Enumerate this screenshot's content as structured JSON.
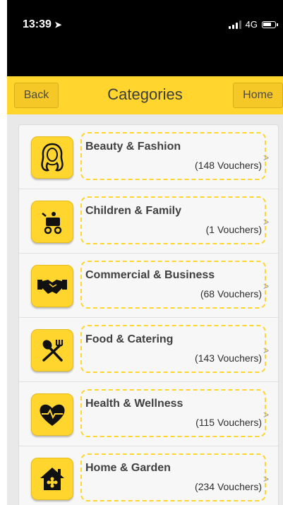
{
  "status": {
    "time": "13:39",
    "network": "4G"
  },
  "nav": {
    "back_label": "Back",
    "title": "Categories",
    "home_label": "Home"
  },
  "categories": [
    {
      "name": "Beauty & Fashion",
      "count": "(148 Vouchers)",
      "icon": "beauty-icon"
    },
    {
      "name": "Children & Family",
      "count": "(1 Vouchers)",
      "icon": "stroller-icon"
    },
    {
      "name": "Commercial & Business",
      "count": "(68 Vouchers)",
      "icon": "handshake-icon"
    },
    {
      "name": "Food & Catering",
      "count": "(143 Vouchers)",
      "icon": "fork-spoon-icon"
    },
    {
      "name": "Health & Wellness",
      "count": "(115 Vouchers)",
      "icon": "heartbeat-icon"
    },
    {
      "name": "Home & Garden",
      "count": "(234 Vouchers)",
      "icon": "house-icon"
    }
  ],
  "colors": {
    "accent": "#ffd52e",
    "status_bar": "#000000"
  }
}
